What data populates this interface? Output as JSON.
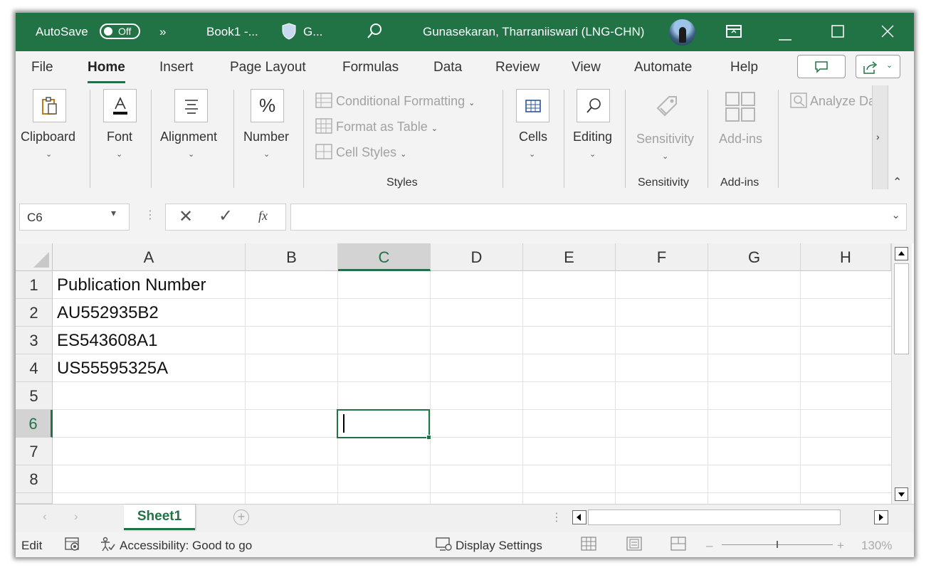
{
  "titlebar": {
    "autosave_label": "AutoSave",
    "autosave_state": "Off",
    "more": "»",
    "doc_title": "Book1  -...",
    "sensitivity_short": "G...",
    "user_name": "Gunasekaran, Tharraniiswari (LNG-CHN)"
  },
  "menu": {
    "tabs": [
      "File",
      "Home",
      "Insert",
      "Page Layout",
      "Formulas",
      "Data",
      "Review",
      "View",
      "Automate",
      "Help"
    ],
    "active": "Home"
  },
  "ribbon": {
    "clipboard": "Clipboard",
    "font": "Font",
    "alignment": "Alignment",
    "number": "Number",
    "conditional_formatting": "Conditional Formatting",
    "format_as_table": "Format as Table",
    "cell_styles": "Cell Styles",
    "styles_group": "Styles",
    "cells": "Cells",
    "editing": "Editing",
    "sensitivity": "Sensitivity",
    "sensitivity_group": "Sensitivity",
    "addins": "Add-ins",
    "addins_group": "Add-ins",
    "analyze": "Analyze Da"
  },
  "formula_bar": {
    "name_box": "C6",
    "fx": "fx",
    "content": ""
  },
  "grid": {
    "columns": [
      "A",
      "B",
      "C",
      "D",
      "E",
      "F",
      "G",
      "H"
    ],
    "selected_column": "C",
    "rows": [
      "1",
      "2",
      "3",
      "4",
      "5",
      "6",
      "7",
      "8"
    ],
    "selected_row": "6",
    "cells": {
      "A1": "Publication Number",
      "A2": "AU552935B2",
      "A3": "ES543608A1",
      "A4": "US55595325A"
    }
  },
  "sheets": {
    "tabs": [
      "Sheet1"
    ],
    "active": "Sheet1"
  },
  "statusbar": {
    "mode": "Edit",
    "accessibility": "Accessibility: Good to go",
    "display_settings": "Display Settings",
    "zoom": "130%"
  },
  "colors": {
    "accent": "#217346",
    "ribbon_bg": "#f3f3f3",
    "disabled_text": "#a2a2a2"
  }
}
